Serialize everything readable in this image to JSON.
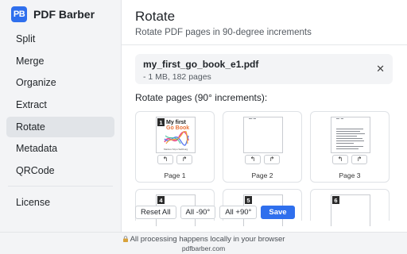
{
  "app": {
    "logo_text": "PB",
    "brand_name": "PDF Barber",
    "accent_color": "#2f6fed"
  },
  "sidebar": {
    "items": [
      {
        "label": "Split"
      },
      {
        "label": "Merge"
      },
      {
        "label": "Organize"
      },
      {
        "label": "Extract"
      },
      {
        "label": "Rotate",
        "active": true
      },
      {
        "label": "Metadata"
      },
      {
        "label": "QRCode"
      }
    ],
    "footer_items": [
      {
        "label": "License"
      }
    ]
  },
  "main": {
    "title": "Rotate",
    "subtitle": "Rotate PDF pages in 90-degree increments",
    "file": {
      "name": "my_first_go_book_e1.pdf",
      "meta": "- 1 MB, 182 pages",
      "remove_icon": "close-icon",
      "remove_glyph": "✕"
    },
    "section_title": "Rotate pages (90° increments):",
    "pages": [
      {
        "number": "1",
        "label": "Page 1",
        "cover_title_line1": "My first",
        "cover_title_line2": "Go Book",
        "cover_sub": "Markus Szpu  Salzburg"
      },
      {
        "number": "2",
        "label": "Page 2"
      },
      {
        "number": "3",
        "label": "Page 3"
      },
      {
        "number": "4"
      },
      {
        "number": "5"
      },
      {
        "number": "6"
      }
    ],
    "rotate_left_glyph": "↰",
    "rotate_right_glyph": "↱",
    "actions": {
      "reset_all": "Reset All",
      "all_minus_90": "All -90°",
      "all_plus_90": "All +90°",
      "save": "Save"
    }
  },
  "footer": {
    "privacy_text": "All processing happens locally in your browser",
    "privacy_icon": "lock-icon",
    "site": "pdfbarber.com"
  }
}
